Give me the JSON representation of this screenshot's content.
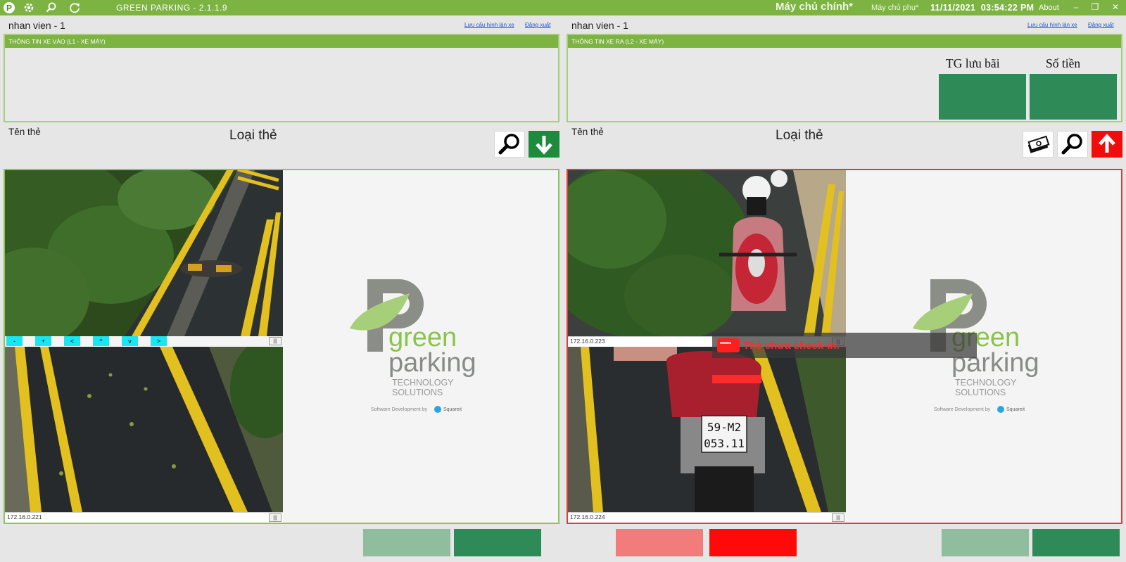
{
  "titlebar": {
    "app_title": "GREEN PARKING - 2.1.1.9",
    "server_main": "Máy chủ chính*",
    "server_sub": "Máy chủ phụ*",
    "date": "11/11/2021",
    "time": "03:54:22 PM",
    "about": "About",
    "icons": [
      "parking-logo-icon",
      "gear-icon",
      "search-icon",
      "refresh-icon",
      "minimize-icon",
      "maximize-icon",
      "close-icon"
    ],
    "accent_color": "#7cb342"
  },
  "left": {
    "user": "nhan vien - 1",
    "link_config": "Lưu cấu hình làn xe",
    "link_logout": "Đăng xuất",
    "info_header": "THÔNG TIN XE VÀO (L1 - XE MÁY)",
    "card_name_label": "Tên thẻ",
    "card_type_label": "Loại thẻ",
    "ptz_buttons": [
      "-",
      "+",
      "<",
      "^",
      "v",
      ">"
    ],
    "cam_top_ip": "",
    "cam_bottom_ip": "172.16.0.221",
    "grip": "|||",
    "frame_color": "#8cc35a"
  },
  "right": {
    "user": "nhan vien - 1",
    "link_config": "Lưu cấu hình làn xe",
    "link_logout": "Đăng xuất",
    "info_header": "THÔNG TIN XE RA (L2 - XE MÁY)",
    "card_name_label": "Tên thẻ",
    "card_type_label": "Loại thẻ",
    "metric_time_label": "TG lưu bãi",
    "metric_fee_label": "Số tiền",
    "cam_top_ip": "172.16.0.223",
    "cam_bottom_ip": "172.16.0.224",
    "grip": "|||",
    "plate_line1": "59-M2",
    "plate_line2": "053.11",
    "alert_text": "Thẻ chưa check-in.",
    "frame_color": "#e33a3a"
  },
  "logo": {
    "word1": "green",
    "word2": "parking",
    "tag1": "TECHNOLOGY",
    "tag2": "SOLUTIONS",
    "credit": "Software Development by",
    "credit_brand": "Squareit"
  }
}
